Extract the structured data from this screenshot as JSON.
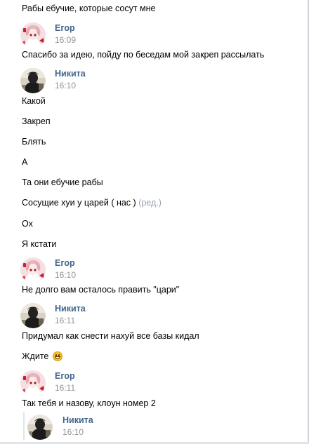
{
  "messages": {
    "top_text": "Рабы ебучие, которые сосут мне",
    "group1": {
      "author": "Егор",
      "time": "16:09",
      "texts": [
        "Спасибо за идею, пойду по беседам мой закреп рассылать"
      ]
    },
    "group2": {
      "author": "Никита",
      "time": "16:10",
      "texts": [
        "Какой",
        "Закреп",
        "Блять",
        "А",
        "Та они ебучие рабы",
        "Сосущие хуи у царей ( нас )",
        "Ох",
        "Я кстати"
      ],
      "edited_label": "(ред.)"
    },
    "group3": {
      "author": "Егор",
      "time": "16:10",
      "texts": [
        "Не долго вам осталось править \"цари\""
      ]
    },
    "group4": {
      "author": "Никита",
      "time": "16:11",
      "texts": [
        "Придумал как снести нахуй все базы кидал",
        "Ждите"
      ],
      "emoji": "grinning-face"
    },
    "group5": {
      "author": "Егор",
      "time": "16:11",
      "texts": [
        "Так тебя и назову, клоун номер 2"
      ]
    },
    "reply": {
      "author": "Никита",
      "time": "16:10"
    }
  },
  "colors": {
    "author_name": "#42648b",
    "timestamp": "#939393",
    "edited": "#9aa4b0"
  }
}
